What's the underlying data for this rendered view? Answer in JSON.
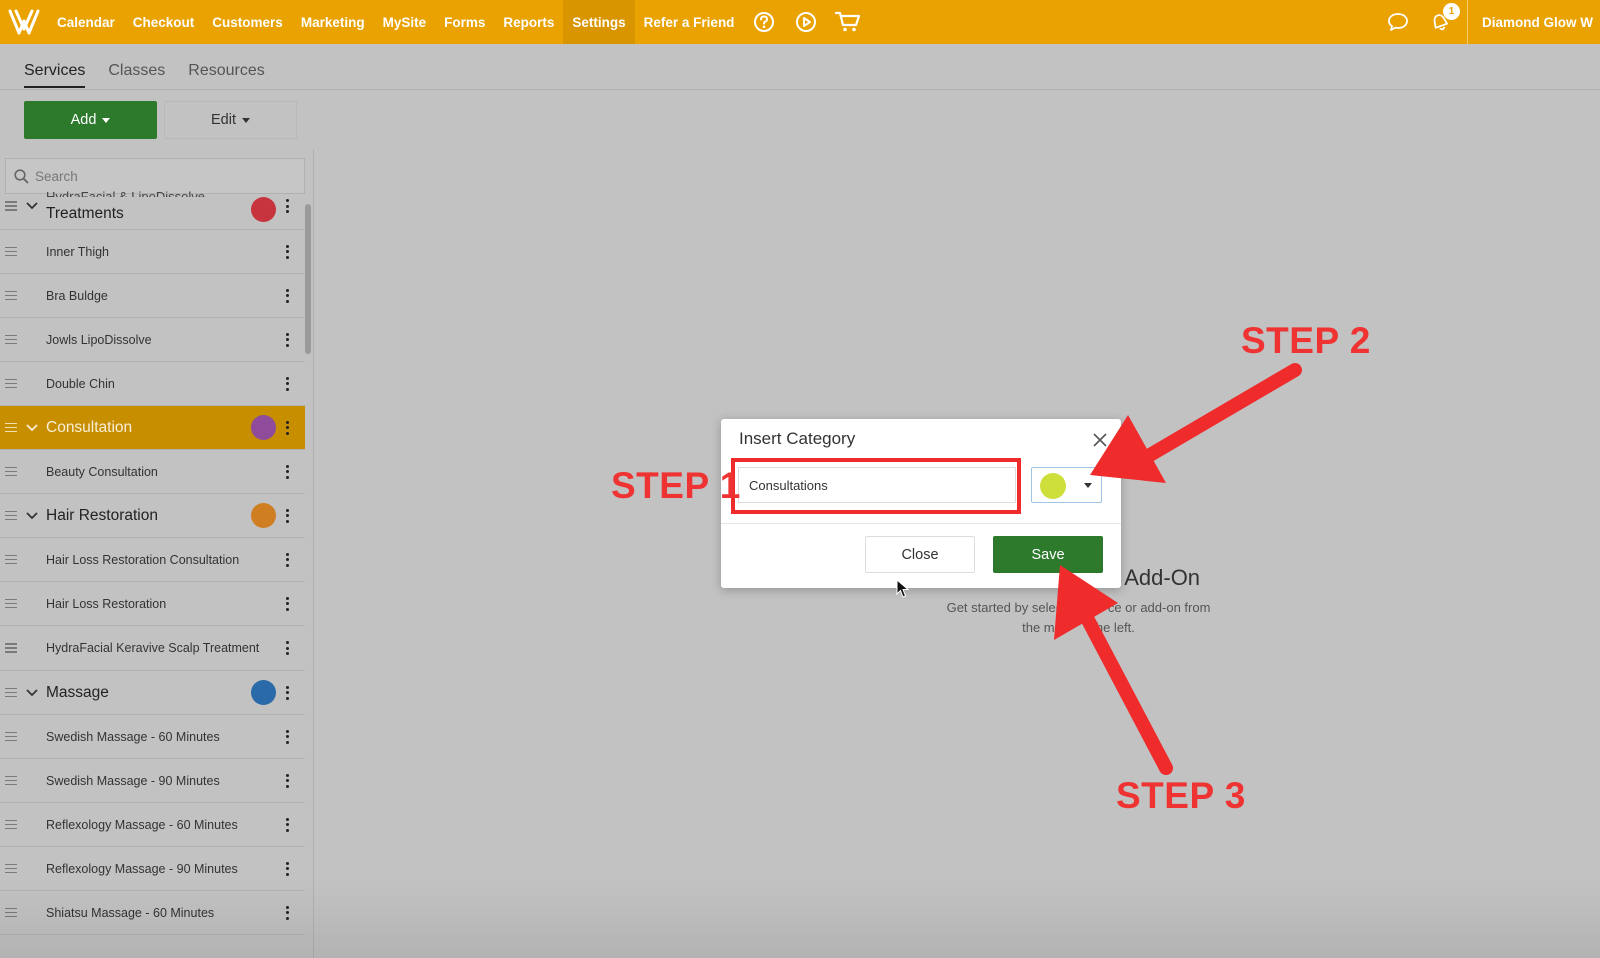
{
  "nav": {
    "items": [
      "Calendar",
      "Checkout",
      "Customers",
      "Marketing",
      "MySite",
      "Forms",
      "Reports",
      "Settings",
      "Refer a Friend"
    ],
    "active": "Settings",
    "notification_count": "1",
    "user_name": "Diamond Glow W"
  },
  "subtabs": {
    "services": "Services",
    "classes": "Classes",
    "resources": "Resources"
  },
  "toolbar": {
    "add_label": "Add",
    "edit_label": "Edit"
  },
  "search": {
    "placeholder": "Search"
  },
  "list": {
    "partial_category": "Treatments",
    "partial_category_top_fragment": "HydraFacial & LipoDissolve",
    "rows": [
      {
        "type": "item",
        "label": "Inner Thigh"
      },
      {
        "type": "item",
        "label": "Bra Buldge"
      },
      {
        "type": "item",
        "label": "Jowls LipoDissolve"
      },
      {
        "type": "item",
        "label": "Double Chin"
      },
      {
        "type": "category",
        "label": "Consultation",
        "selected": true
      },
      {
        "type": "item",
        "label": "Beauty Consultation"
      },
      {
        "type": "category",
        "label": "Hair Restoration"
      },
      {
        "type": "item",
        "label": "Hair Loss Restoration Consultation"
      },
      {
        "type": "item",
        "label": "Hair Loss Restoration"
      },
      {
        "type": "item",
        "label": "HydraFacial Keravive Scalp Treatment"
      },
      {
        "type": "category",
        "label": "Massage"
      },
      {
        "type": "item",
        "label": "Swedish Massage - 60 Minutes"
      },
      {
        "type": "item",
        "label": "Swedish Massage - 90 Minutes"
      },
      {
        "type": "item",
        "label": "Reflexology Massage - 60 Minutes"
      },
      {
        "type": "item",
        "label": "Reflexology Massage - 90 Minutes"
      },
      {
        "type": "item",
        "label": "Shiatsu Massage - 60 Minutes"
      }
    ]
  },
  "colors": {
    "nav_bg": "#e9a200",
    "primary_green": "#2d7a2d",
    "treatments_dot": "#c8343e",
    "consultation_dot": "#8e4c9a",
    "hair_restoration_dot": "#cf7e22",
    "massage_dot": "#2a6aa8",
    "selected_color": "#cedf3c",
    "annotation_red": "#ef2b2b"
  },
  "empty_state": {
    "title_fragment": "r Add-On",
    "line1_fragment_a": "Get started by select",
    "line1_fragment_b": "ce or add-on from",
    "line2_fragment_a": "the me",
    "line2_fragment_b": "he left."
  },
  "modal": {
    "title": "Insert Category",
    "input_value": "Consultations",
    "close_label": "Close",
    "save_label": "Save"
  },
  "annotations": {
    "step1": "STEP 1",
    "step2": "STEP 2",
    "step3": "STEP 3"
  }
}
